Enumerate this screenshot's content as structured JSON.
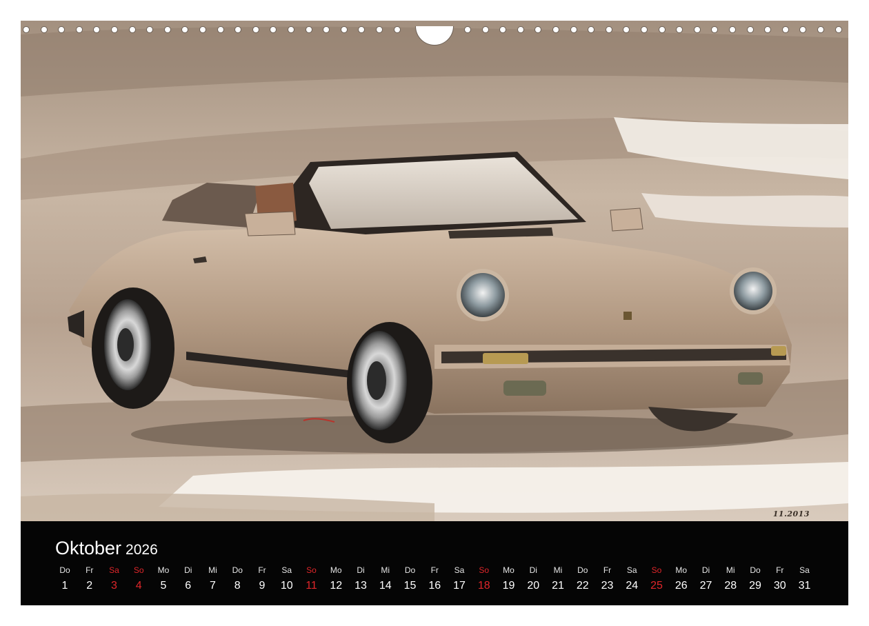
{
  "calendar": {
    "month": "Oktober",
    "year": "2026",
    "weekday_color": "#e6e6e6",
    "holiday_color": "#e0262a",
    "days": [
      {
        "wd": "Do",
        "num": "1",
        "red": false
      },
      {
        "wd": "Fr",
        "num": "2",
        "red": false
      },
      {
        "wd": "Sa",
        "num": "3",
        "red": true
      },
      {
        "wd": "So",
        "num": "4",
        "red": true
      },
      {
        "wd": "Mo",
        "num": "5",
        "red": false
      },
      {
        "wd": "Di",
        "num": "6",
        "red": false
      },
      {
        "wd": "Mi",
        "num": "7",
        "red": false
      },
      {
        "wd": "Do",
        "num": "8",
        "red": false
      },
      {
        "wd": "Fr",
        "num": "9",
        "red": false
      },
      {
        "wd": "Sa",
        "num": "10",
        "red": false
      },
      {
        "wd": "So",
        "num": "11",
        "red": true
      },
      {
        "wd": "Mo",
        "num": "12",
        "red": false
      },
      {
        "wd": "Di",
        "num": "13",
        "red": false
      },
      {
        "wd": "Mi",
        "num": "14",
        "red": false
      },
      {
        "wd": "Do",
        "num": "15",
        "red": false
      },
      {
        "wd": "Fr",
        "num": "16",
        "red": false
      },
      {
        "wd": "Sa",
        "num": "17",
        "red": false
      },
      {
        "wd": "So",
        "num": "18",
        "red": true
      },
      {
        "wd": "Mo",
        "num": "19",
        "red": false
      },
      {
        "wd": "Di",
        "num": "20",
        "red": false
      },
      {
        "wd": "Mi",
        "num": "21",
        "red": false
      },
      {
        "wd": "Do",
        "num": "22",
        "red": false
      },
      {
        "wd": "Fr",
        "num": "23",
        "red": false
      },
      {
        "wd": "Sa",
        "num": "24",
        "red": false
      },
      {
        "wd": "So",
        "num": "25",
        "red": true
      },
      {
        "wd": "Mo",
        "num": "26",
        "red": false
      },
      {
        "wd": "Di",
        "num": "27",
        "red": false
      },
      {
        "wd": "Mi",
        "num": "28",
        "red": false
      },
      {
        "wd": "Do",
        "num": "29",
        "red": false
      },
      {
        "wd": "Fr",
        "num": "30",
        "red": false
      },
      {
        "wd": "Sa",
        "num": "31",
        "red": false
      }
    ]
  },
  "artwork": {
    "signature_year": "11.2013",
    "car_color": "#b89e86",
    "background_color": "#a08a78"
  }
}
